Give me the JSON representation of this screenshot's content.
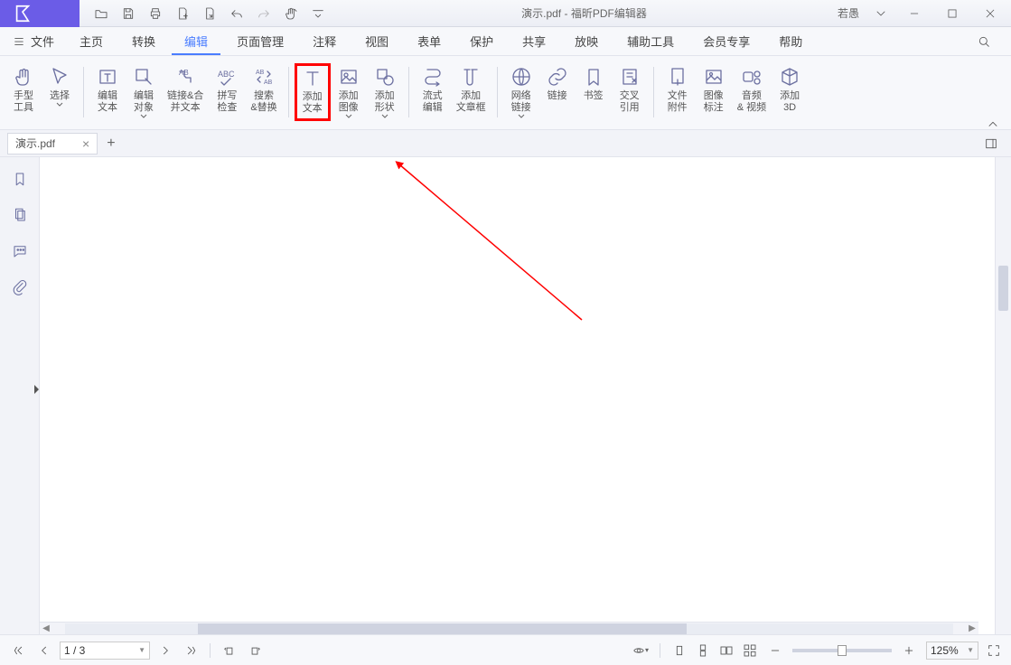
{
  "title": {
    "filename": "演示.pdf",
    "app": "福昕PDF编辑器",
    "user": "若愚"
  },
  "menu": {
    "file": "文件",
    "items": [
      "主页",
      "转换",
      "编辑",
      "页面管理",
      "注释",
      "视图",
      "表单",
      "保护",
      "共享",
      "放映",
      "辅助工具",
      "会员专享",
      "帮助"
    ],
    "active_index": 2
  },
  "ribbon": {
    "hand": "手型\n工具",
    "select": "选择",
    "edit_text": "编辑\n文本",
    "edit_object": "编辑\n对象",
    "link_merge": "链接&合\n并文本",
    "spell": "拼写\n检查",
    "search_replace": "搜索\n&替换",
    "add_text": "添加\n文本",
    "add_image": "添加\n图像",
    "add_shape": "添加\n形状",
    "flow_edit": "流式\n编辑",
    "add_textbox": "添加\n文章框",
    "web_link": "网络\n链接",
    "link": "链接",
    "bookmark": "书签",
    "crossref": "交叉\n引用",
    "file_attach": "文件\n附件",
    "image_annot": "图像\n标注",
    "audio_video": "音频\n& 视频",
    "add_3d": "添加\n3D"
  },
  "tabs": {
    "active": "演示.pdf"
  },
  "status": {
    "page": "1 / 3",
    "zoom": "125%"
  }
}
